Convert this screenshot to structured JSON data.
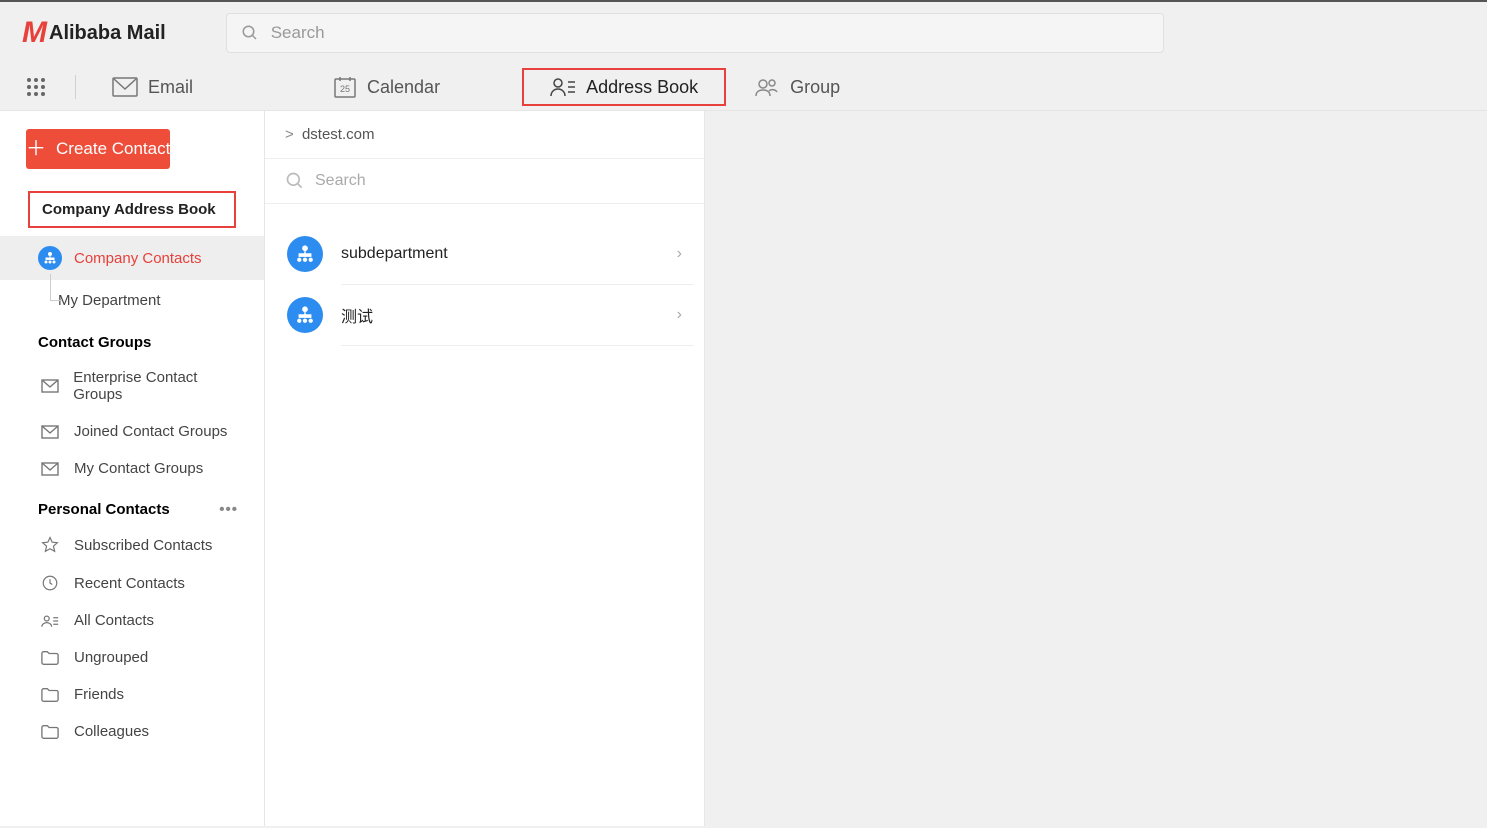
{
  "brand": {
    "name": "Alibaba Mail"
  },
  "top_search": {
    "placeholder": "Search"
  },
  "tabs": {
    "email": "Email",
    "calendar": "Calendar",
    "calendar_day": "25",
    "address_book": "Address Book",
    "group": "Group"
  },
  "sidebar": {
    "create_label": "Create Contact",
    "company_ab_title": "Company Address Book",
    "company_contacts": "Company Contacts",
    "my_department": "My Department",
    "contact_groups_title": "Contact Groups",
    "enterprise_groups": "Enterprise Contact Groups",
    "joined_groups": "Joined Contact Groups",
    "my_contact_groups": "My Contact Groups",
    "personal_title": "Personal Contacts",
    "subscribed": "Subscribed Contacts",
    "recent": "Recent Contacts",
    "all_contacts": "All Contacts",
    "ungrouped": "Ungrouped",
    "friends": "Friends",
    "colleagues": "Colleagues"
  },
  "content": {
    "breadcrumb_root": "dstest.com",
    "search_placeholder": "Search",
    "departments": [
      {
        "name": "subdepartment"
      },
      {
        "name": "测试"
      }
    ]
  }
}
